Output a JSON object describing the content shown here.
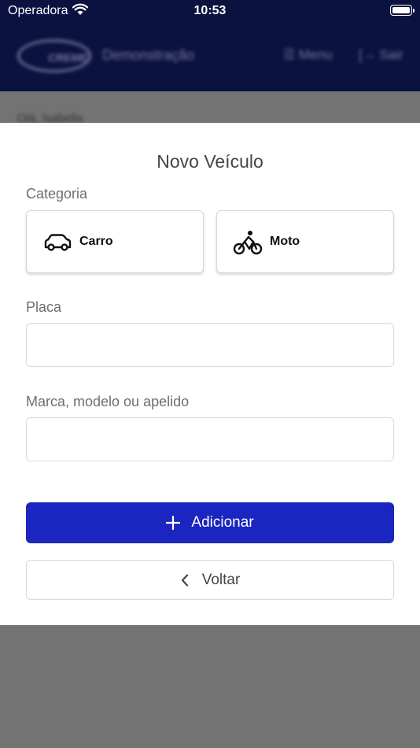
{
  "status_bar": {
    "carrier": "Operadora",
    "time": "10:53"
  },
  "app_bar": {
    "logo_text": "CREME",
    "title": "Demonstração",
    "menu_label": "☰ Menu",
    "exit_label": "[→ Sair"
  },
  "background": {
    "greeting": "Olá, Isabella"
  },
  "modal": {
    "title": "Novo Veículo",
    "category_label": "Categoria",
    "categories": [
      {
        "label": "Carro",
        "icon": "car-icon"
      },
      {
        "label": "Moto",
        "icon": "bicycle-icon"
      }
    ],
    "plate_label": "Placa",
    "plate_value": "",
    "plate_placeholder": "",
    "model_label": "Marca, modelo ou apelido",
    "model_value": "",
    "model_placeholder": "",
    "add_button": {
      "label": "Adicionar",
      "icon": "plus-icon"
    },
    "back_button": {
      "label": "Voltar",
      "icon": "chevron-left-icon"
    }
  },
  "colors": {
    "header_bg": "#0c1240",
    "primary": "#1b26c0",
    "overlay": "#737373"
  }
}
